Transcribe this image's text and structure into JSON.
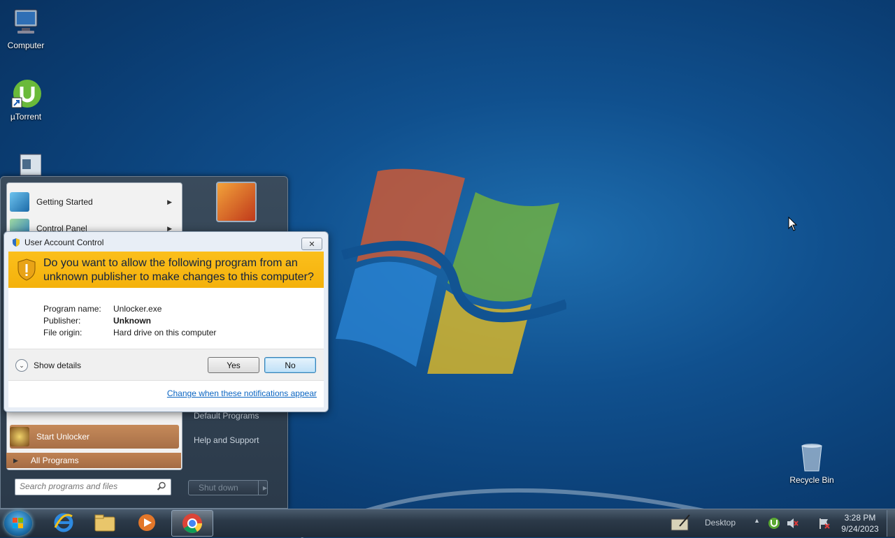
{
  "desktop": {
    "icons": [
      {
        "label": "Computer"
      },
      {
        "label": "µTorrent"
      },
      {
        "label": "Recycle Bin"
      }
    ]
  },
  "start_menu": {
    "items": [
      {
        "label": "Getting Started"
      },
      {
        "label": "Control Panel"
      },
      {
        "label": "Start Unlocker"
      }
    ],
    "all_programs": "All Programs",
    "search_placeholder": "Search programs and files",
    "right_items": [
      "Default Programs",
      "Help and Support"
    ],
    "shutdown_label": "Shut down"
  },
  "uac": {
    "title": "User Account Control",
    "question": "Do you want to allow the following program from an unknown publisher to make changes to this computer?",
    "fields": [
      {
        "key": "Program name:",
        "value": "Unlocker.exe",
        "bold": false
      },
      {
        "key": "Publisher:",
        "value": "Unknown",
        "bold": true
      },
      {
        "key": "File origin:",
        "value": "Hard drive on this computer",
        "bold": false
      }
    ],
    "show_details": "Show details",
    "yes_label": "Yes",
    "no_label": "No",
    "link": "Change when these notifications appear",
    "banner_color": "#fbbf1c"
  },
  "taskbar": {
    "desktop_label": "Desktop",
    "clock_time": "3:28 PM",
    "clock_date": "9/24/2023"
  }
}
